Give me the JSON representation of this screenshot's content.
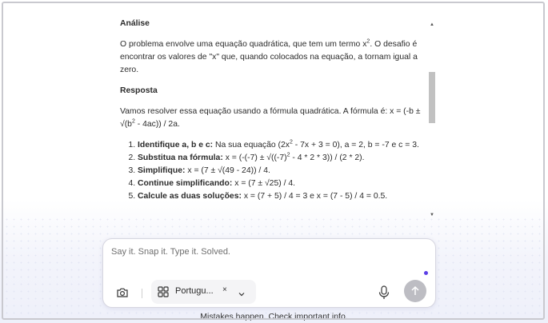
{
  "response": {
    "analysis_heading": "Análise",
    "analysis_text_a": "O problema envolve uma equação quadrática, que tem um termo x",
    "analysis_sup": "2",
    "analysis_text_b": ". O desafio é encontrar os valores de \"x\" que, quando colocados na equação, a tornam igual a zero.",
    "answer_heading": "Resposta",
    "answer_text_a": "Vamos resolver essa equação usando a fórmula quadrática. A fórmula é: x = (-b ± √(b",
    "answer_sup": "2",
    "answer_text_b": " - 4ac)) / 2a.",
    "steps": [
      {
        "label": "Identifique a, b e c:",
        "text_a": " Na sua equação (2x",
        "sup": "2",
        "text_b": " - 7x + 3 = 0), a = 2, b = -7 e c = 3."
      },
      {
        "label": "Substitua na fórmula:",
        "text_a": " x = (-(-7) ± √((-7)",
        "sup": "2",
        "text_b": " - 4 * 2 * 3)) / (2 * 2)."
      },
      {
        "label": "Simplifique:",
        "text_a": " x = (7 ± √(49 - 24)) / 4."
      },
      {
        "label": "Continue simplificando:",
        "text_a": " x = (7 ± √25) / 4."
      },
      {
        "label": "Calcule as duas soluções:",
        "text_a": " x = (7 + 5) / 4 = 3 e x = (7 - 5) / 4 = 0.5."
      }
    ]
  },
  "composer": {
    "placeholder": "Say it. Snap it. Type it. Solved.",
    "language": "Portugu...",
    "clear": "×",
    "icons": {
      "camera": "camera-icon",
      "language": "grid-icon",
      "chevron": "chevron-down-icon",
      "mic": "microphone-icon",
      "send": "arrow-up-icon"
    },
    "accent_color": "#5b3ee6"
  },
  "disclaimer": "Mistakes happen. Check important info."
}
